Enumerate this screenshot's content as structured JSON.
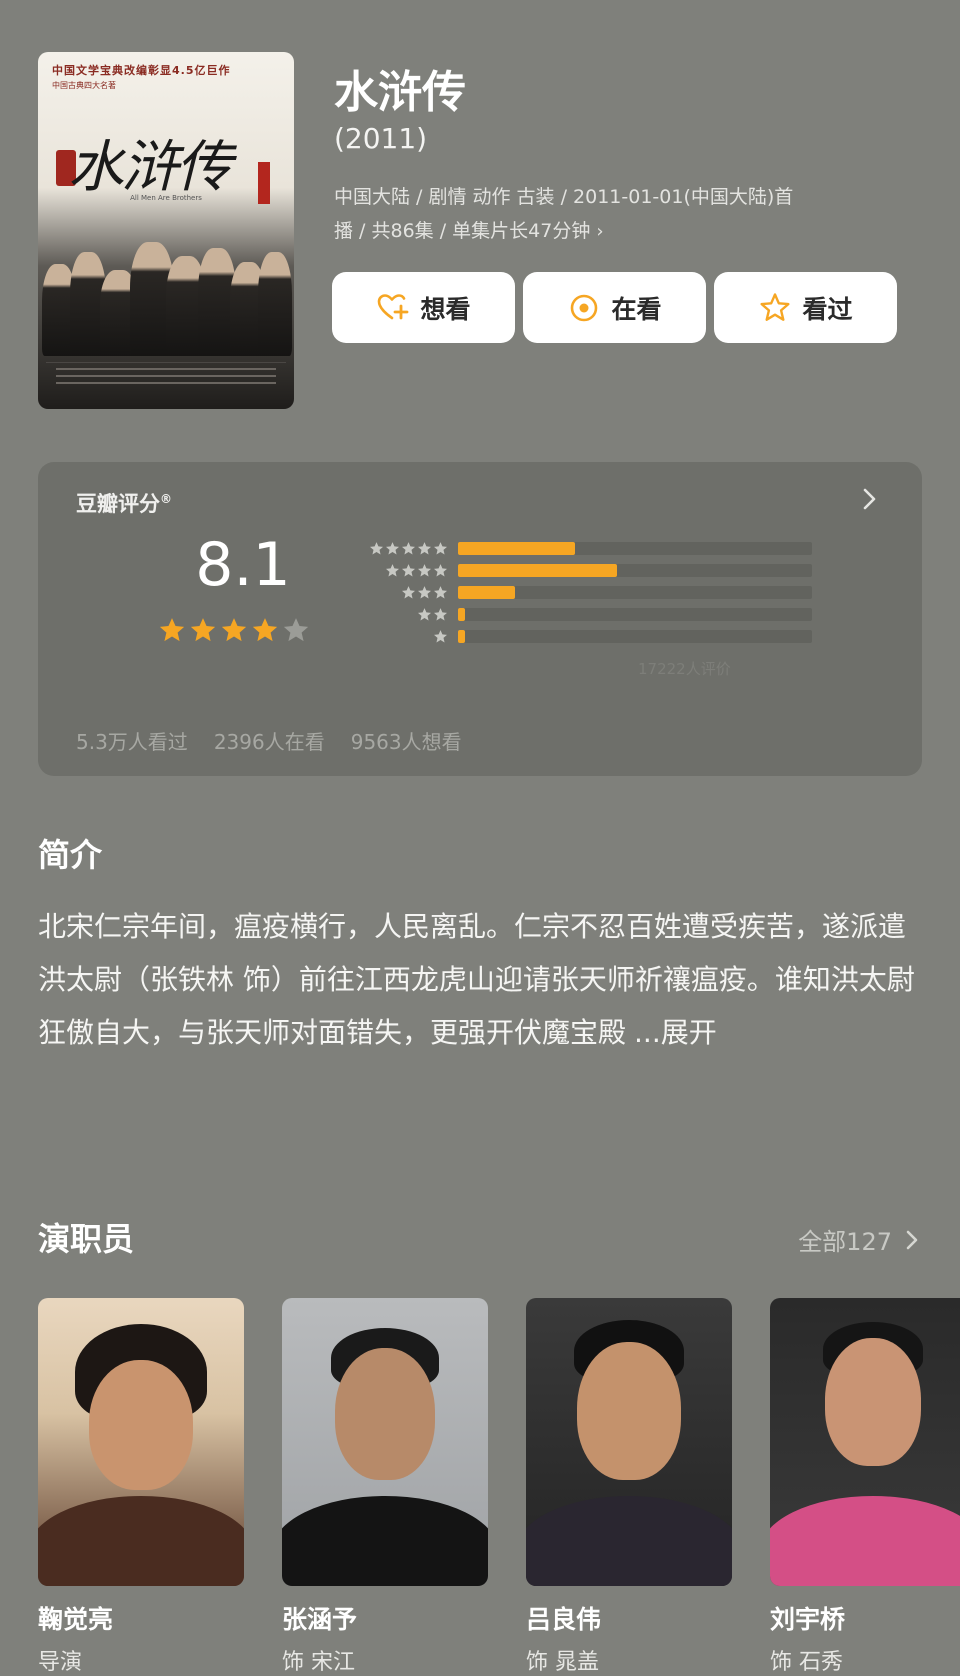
{
  "show": {
    "title": "水浒传",
    "year": "(2011)",
    "meta_line1": "中国大陆 / 剧情 动作 古装 / 2011-01-01(中国大陆)首",
    "meta_line2": "播 / 共86集 / 单集片长47分钟",
    "meta_chevron": "›"
  },
  "poster": {
    "topline": "中国文学宝典改编彰显4.5亿巨作",
    "topline2": "中国古典四大名著",
    "title_art": "水浒传",
    "subtitle_art": "All Men Are Brothers"
  },
  "actions": [
    {
      "label": "想看",
      "icon": "heart-plus-icon"
    },
    {
      "label": "在看",
      "icon": "target-circle-icon"
    },
    {
      "label": "看过",
      "icon": "star-outline-icon"
    }
  ],
  "rating": {
    "label": "豆瓣评分",
    "label_mark": "®",
    "score": "8.1",
    "stars_full": 4,
    "stars_total": 5,
    "distribution": [
      {
        "stars": 5,
        "fraction": 0.33
      },
      {
        "stars": 4,
        "fraction": 0.45
      },
      {
        "stars": 3,
        "fraction": 0.16
      },
      {
        "stars": 2,
        "fraction": 0.02
      },
      {
        "stars": 1,
        "fraction": 0.02
      }
    ],
    "count": "17222人评价",
    "stats": [
      "5.3万人看过",
      "2396人在看",
      "9563人想看"
    ],
    "colors": {
      "accent": "#f6a623",
      "track": "#62635e",
      "star_empty": "#9b9c97"
    }
  },
  "synopsis": {
    "title": "简介",
    "text": "北宋仁宗年间，瘟疫横行，人民离乱。仁宗不忍百姓遭受疾苦，遂派遣洪太尉（张铁林 饰）前往江西龙虎山迎请张天师祈禳瘟疫。谁知洪太尉狂傲自大，与张天师对面错失，更强开伏魔宝殿",
    "more": "...展开"
  },
  "cast": {
    "title": "演职员",
    "all_label": "全部127",
    "members": [
      {
        "name": "鞠觉亮",
        "role": "导演"
      },
      {
        "name": "张涵予",
        "role": "饰 宋江"
      },
      {
        "name": "吕良伟",
        "role": "饰 晁盖"
      },
      {
        "name": "刘宇桥",
        "role": "饰 石秀"
      }
    ]
  }
}
